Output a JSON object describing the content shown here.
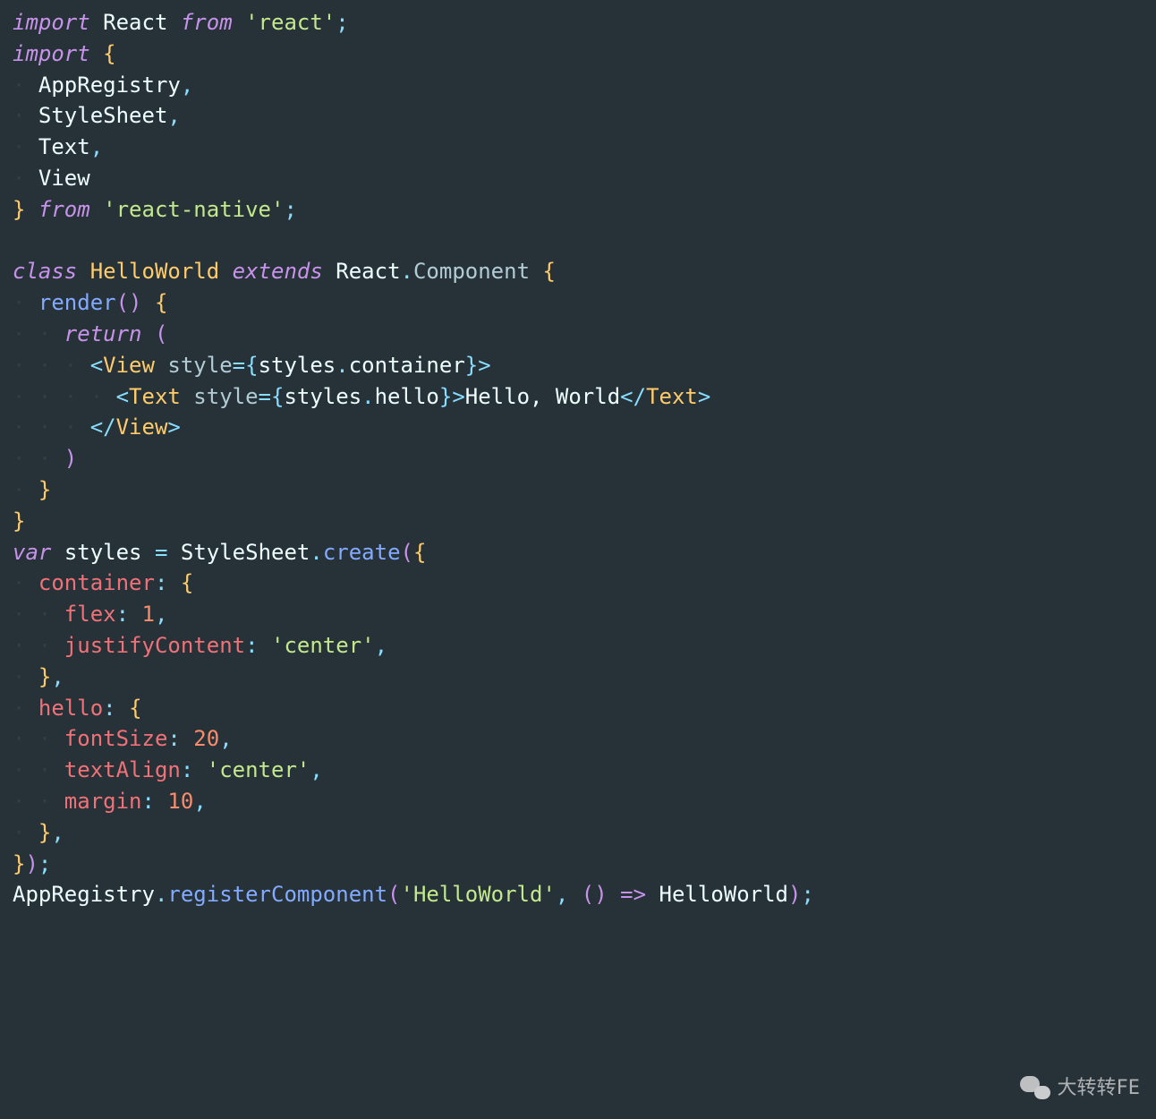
{
  "code": {
    "line1": {
      "import": "import",
      "react": "React",
      "from": "from",
      "str": "'react'",
      "semi": ";"
    },
    "line2": {
      "import": "import",
      "brace": "{"
    },
    "line3": {
      "ident": "AppRegistry",
      "comma": ","
    },
    "line4": {
      "ident": "StyleSheet",
      "comma": ","
    },
    "line5": {
      "ident": "Text",
      "comma": ","
    },
    "line6": {
      "ident": "View"
    },
    "line7": {
      "brace": "}",
      "from": "from",
      "str": "'react-native'",
      "semi": ";"
    },
    "line9": {
      "class": "class",
      "name": "HelloWorld",
      "extends": "extends",
      "react": "React",
      "dot": ".",
      "comp": "Component",
      "brace": "{"
    },
    "line10": {
      "method": "render",
      "paren": "()",
      "brace": "{"
    },
    "line11": {
      "return": "return",
      "paren": "("
    },
    "line12": {
      "lt": "<",
      "tag": "View",
      "attr": "style",
      "eq": "=",
      "bl": "{",
      "obj": "styles",
      "dot": ".",
      "prop": "container",
      "br": "}",
      "gt": ">"
    },
    "line13": {
      "lt": "<",
      "tag": "Text",
      "attr": "style",
      "eq": "=",
      "bl": "{",
      "obj": "styles",
      "dot": ".",
      "prop": "hello",
      "br": "}",
      "gt": ">",
      "text": "Hello, World",
      "lt2": "</",
      "tag2": "Text",
      "gt2": ">"
    },
    "line14": {
      "lt": "</",
      "tag": "View",
      "gt": ">"
    },
    "line15": {
      "paren": ")"
    },
    "line16": {
      "brace": "}"
    },
    "line17": {
      "brace": "}"
    },
    "line18": {
      "var": "var",
      "ident": "styles",
      "eq": "=",
      "obj": "StyleSheet",
      "dot": ".",
      "method": "create",
      "paren": "(",
      "brace": "{"
    },
    "line19": {
      "key": "container",
      "colon": ":",
      "brace": "{"
    },
    "line20": {
      "key": "flex",
      "colon": ":",
      "num": "1",
      "comma": ","
    },
    "line21": {
      "key": "justifyContent",
      "colon": ":",
      "str": "'center'",
      "comma": ","
    },
    "line22": {
      "brace": "}",
      "comma": ","
    },
    "line23": {
      "key": "hello",
      "colon": ":",
      "brace": "{"
    },
    "line24": {
      "key": "fontSize",
      "colon": ":",
      "num": "20",
      "comma": ","
    },
    "line25": {
      "key": "textAlign",
      "colon": ":",
      "str": "'center'",
      "comma": ","
    },
    "line26": {
      "key": "margin",
      "colon": ":",
      "num": "10",
      "comma": ","
    },
    "line27": {
      "brace": "}",
      "comma": ","
    },
    "line28": {
      "brace": "}",
      "paren": ")",
      "semi": ";"
    },
    "line29": {
      "obj": "AppRegistry",
      "dot": ".",
      "method": "registerComponent",
      "paren": "(",
      "str": "'HelloWorld'",
      "comma": ",",
      "paren2": "()",
      "arrow": "=>",
      "ident": "HelloWorld",
      "paren3": ")",
      "semi": ";"
    }
  },
  "watermark": "大转转FE"
}
